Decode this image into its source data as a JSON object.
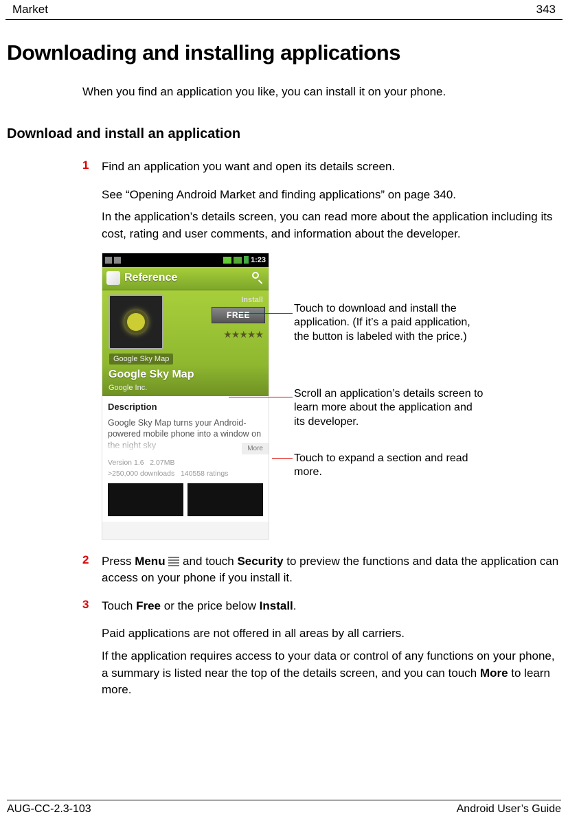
{
  "header": {
    "section": "Market",
    "page_num": "343"
  },
  "title": "Downloading and installing applications",
  "intro": "When you find an application you like, you can install it on your phone.",
  "subtitle": "Download and install an application",
  "steps": {
    "s1": {
      "num": "1",
      "a": "Find an application you want and open its details screen.",
      "b": "See “Opening Android Market and finding applications” on page 340.",
      "c": "In the application’s details screen, you can read more about the application including its cost, rating and user comments, and information about the developer."
    },
    "s2": {
      "num": "2",
      "pre": "Press ",
      "b1": "Menu",
      "mid1": " ",
      "mid2": " and touch ",
      "b2": "Security",
      "post": " to preview the functions and data the application can access on your phone if you install it."
    },
    "s3": {
      "num": "3",
      "pre": "Touch ",
      "b1": "Free",
      "mid": " or the price below ",
      "b2": "Install",
      "post": ".",
      "p2": "Paid applications are not offered in all areas by all carriers.",
      "p3a": "If the application requires access to your data or control of any functions on your phone, a summary is listed near the top of the details screen, and you can touch ",
      "p3b": "More",
      "p3c": " to learn more."
    }
  },
  "phone": {
    "time": "1:23",
    "header": "Reference",
    "install_label": "Install",
    "free_label": "FREE",
    "stars": "★★★★★",
    "category": "Google Sky Map",
    "app_name": "Google Sky Map",
    "developer": "Google Inc.",
    "desc_header": "Description",
    "desc_text": "Google Sky Map turns your Android-powered mobile phone into a window on the night sky",
    "more": "More",
    "meta1": "Version 1.6   2.07MB",
    "meta2": ">250,000 downloads   140558 ratings"
  },
  "callouts": {
    "c1": "Touch to download and install the application. (If it’s a paid application, the button is labeled with the price.)",
    "c2": "Scroll an application’s details screen to learn more about the application and its developer.",
    "c3": "Touch to expand a section and read more."
  },
  "footer": {
    "left": "AUG-CC-2.3-103",
    "right": "Android User’s Guide"
  }
}
